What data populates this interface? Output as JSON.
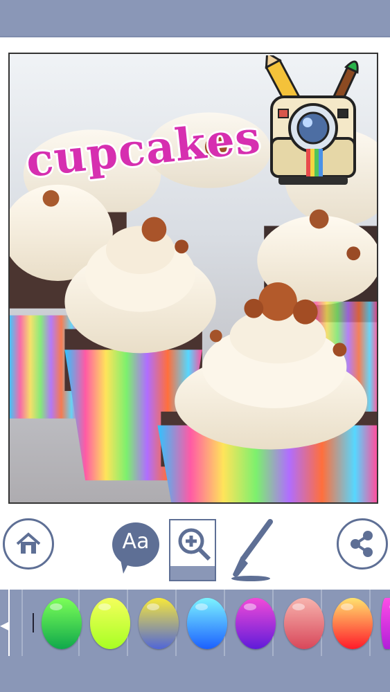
{
  "canvas": {
    "sticker_text": "cupcakes"
  },
  "toolbar": {
    "home_icon": "house-icon",
    "text_icon": "speech-bubble-icon",
    "text_label": "Aa",
    "zoom_icon": "magnifier-plus-icon",
    "brush_icon": "paintbrush-icon",
    "share_icon": "share-icon"
  },
  "palette": {
    "swatches": [
      {
        "name": "green",
        "from": "#7cff57",
        "to": "#0fa84b"
      },
      {
        "name": "yellow",
        "from": "#f4ff5c",
        "to": "#a7ff23"
      },
      {
        "name": "yellow-blue",
        "from": "#f7e83a",
        "to": "#5066d8"
      },
      {
        "name": "cyan",
        "from": "#7cf3ff",
        "to": "#1b60ff"
      },
      {
        "name": "purple",
        "from": "#f24bd8",
        "to": "#5f1bd9"
      },
      {
        "name": "salmon",
        "from": "#f7b3ad",
        "to": "#d8475a"
      },
      {
        "name": "fire",
        "from": "#ffe26e",
        "to": "#ff1a2a"
      },
      {
        "name": "magenta-partial",
        "from": "#ff4de6",
        "to": "#b11fd8"
      }
    ]
  },
  "colors": {
    "bar": "#8a97b7",
    "icon": "#5e6f95",
    "sticker": "#d62fb0"
  }
}
